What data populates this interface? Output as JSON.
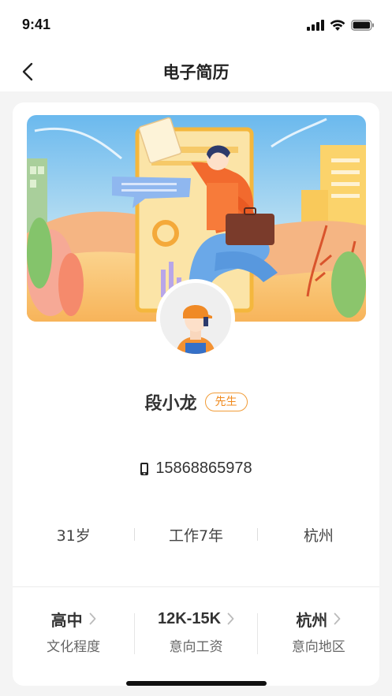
{
  "status_bar": {
    "time": "9:41"
  },
  "nav": {
    "title": "电子简历"
  },
  "profile": {
    "name": "段小龙",
    "gender_badge": "先生",
    "phone": "15868865978",
    "stats": [
      "31岁",
      "工作7年",
      "杭州"
    ]
  },
  "info": [
    {
      "value": "高中",
      "label": "文化程度"
    },
    {
      "value": "12K-15K",
      "label": "意向工资"
    },
    {
      "value": "杭州",
      "label": "意向地区"
    }
  ],
  "icons": {
    "back": "chevron-left-icon",
    "phone": "phone-icon",
    "chevron": "chevron-right-icon"
  },
  "colors": {
    "accent": "#f0891c",
    "background": "#f4f4f4",
    "card": "#ffffff"
  }
}
